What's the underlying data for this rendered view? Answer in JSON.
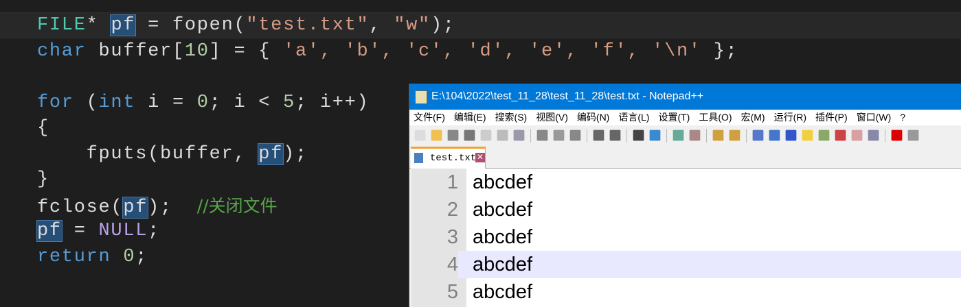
{
  "code": {
    "line1": {
      "type": "FILE",
      "star": "* ",
      "var": "pf",
      "rest": " = fopen(",
      "s1": "\"test.txt\"",
      "comma": ", ",
      "s2": "\"w\"",
      "end": ");"
    },
    "line2": {
      "kw": "char",
      "a": " buffer[",
      "num": "10",
      "b": "] = { ",
      "chars": "'a', 'b', 'c', 'd', 'e', 'f', '\\n'",
      "c": " };"
    },
    "line4": {
      "kw": "for",
      "a": " (",
      "kw2": "int",
      "b": " i = ",
      "n0": "0",
      "c": "; i < ",
      "n5": "5",
      "d": "; i++)"
    },
    "line5": "{",
    "line6": {
      "a": "    fputs(buffer, ",
      "var": "pf",
      "b": ");"
    },
    "line7": "}",
    "line8": {
      "a": "fclose(",
      "var": "pf",
      "b": ");  ",
      "comment": "//关闭文件"
    },
    "line9": {
      "var": "pf",
      "a": " = ",
      "null": "NULL",
      "b": ";"
    },
    "line10": {
      "kw": "return",
      "a": " ",
      "num": "0",
      "b": ";"
    }
  },
  "notepad": {
    "title": "E:\\104\\2022\\test_11_28\\test_11_28\\test.txt - Notepad++",
    "menu": [
      "文件(F)",
      "编辑(E)",
      "搜索(S)",
      "视图(V)",
      "编码(N)",
      "语言(L)",
      "设置(T)",
      "工具(O)",
      "宏(M)",
      "运行(R)",
      "插件(P)",
      "窗口(W)",
      "?"
    ],
    "tab": "test.txt",
    "lines": [
      {
        "n": "1",
        "t": "abcdef"
      },
      {
        "n": "2",
        "t": "abcdef"
      },
      {
        "n": "3",
        "t": "abcdef"
      },
      {
        "n": "4",
        "t": "abcdef"
      },
      {
        "n": "5",
        "t": "abcdef"
      }
    ],
    "current_line": 4
  },
  "colors": {
    "titlebar": "#0078d7",
    "current_line": "#e8e8ff",
    "editor_bg": "#1e1e1e"
  }
}
